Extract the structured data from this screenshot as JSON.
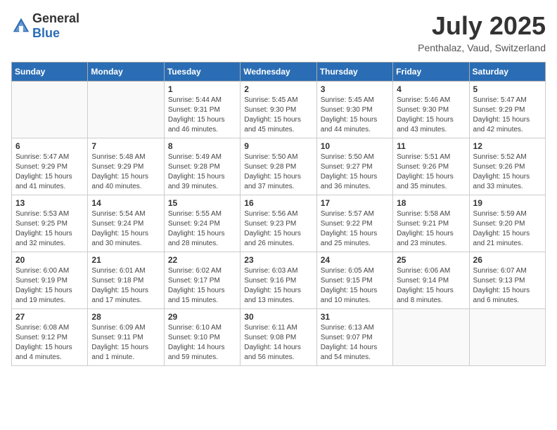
{
  "header": {
    "logo_general": "General",
    "logo_blue": "Blue",
    "month": "July 2025",
    "location": "Penthalaz, Vaud, Switzerland"
  },
  "weekdays": [
    "Sunday",
    "Monday",
    "Tuesday",
    "Wednesday",
    "Thursday",
    "Friday",
    "Saturday"
  ],
  "weeks": [
    [
      {
        "day": "",
        "info": ""
      },
      {
        "day": "",
        "info": ""
      },
      {
        "day": "1",
        "info": "Sunrise: 5:44 AM\nSunset: 9:31 PM\nDaylight: 15 hours and 46 minutes."
      },
      {
        "day": "2",
        "info": "Sunrise: 5:45 AM\nSunset: 9:30 PM\nDaylight: 15 hours and 45 minutes."
      },
      {
        "day": "3",
        "info": "Sunrise: 5:45 AM\nSunset: 9:30 PM\nDaylight: 15 hours and 44 minutes."
      },
      {
        "day": "4",
        "info": "Sunrise: 5:46 AM\nSunset: 9:30 PM\nDaylight: 15 hours and 43 minutes."
      },
      {
        "day": "5",
        "info": "Sunrise: 5:47 AM\nSunset: 9:29 PM\nDaylight: 15 hours and 42 minutes."
      }
    ],
    [
      {
        "day": "6",
        "info": "Sunrise: 5:47 AM\nSunset: 9:29 PM\nDaylight: 15 hours and 41 minutes."
      },
      {
        "day": "7",
        "info": "Sunrise: 5:48 AM\nSunset: 9:29 PM\nDaylight: 15 hours and 40 minutes."
      },
      {
        "day": "8",
        "info": "Sunrise: 5:49 AM\nSunset: 9:28 PM\nDaylight: 15 hours and 39 minutes."
      },
      {
        "day": "9",
        "info": "Sunrise: 5:50 AM\nSunset: 9:28 PM\nDaylight: 15 hours and 37 minutes."
      },
      {
        "day": "10",
        "info": "Sunrise: 5:50 AM\nSunset: 9:27 PM\nDaylight: 15 hours and 36 minutes."
      },
      {
        "day": "11",
        "info": "Sunrise: 5:51 AM\nSunset: 9:26 PM\nDaylight: 15 hours and 35 minutes."
      },
      {
        "day": "12",
        "info": "Sunrise: 5:52 AM\nSunset: 9:26 PM\nDaylight: 15 hours and 33 minutes."
      }
    ],
    [
      {
        "day": "13",
        "info": "Sunrise: 5:53 AM\nSunset: 9:25 PM\nDaylight: 15 hours and 32 minutes."
      },
      {
        "day": "14",
        "info": "Sunrise: 5:54 AM\nSunset: 9:24 PM\nDaylight: 15 hours and 30 minutes."
      },
      {
        "day": "15",
        "info": "Sunrise: 5:55 AM\nSunset: 9:24 PM\nDaylight: 15 hours and 28 minutes."
      },
      {
        "day": "16",
        "info": "Sunrise: 5:56 AM\nSunset: 9:23 PM\nDaylight: 15 hours and 26 minutes."
      },
      {
        "day": "17",
        "info": "Sunrise: 5:57 AM\nSunset: 9:22 PM\nDaylight: 15 hours and 25 minutes."
      },
      {
        "day": "18",
        "info": "Sunrise: 5:58 AM\nSunset: 9:21 PM\nDaylight: 15 hours and 23 minutes."
      },
      {
        "day": "19",
        "info": "Sunrise: 5:59 AM\nSunset: 9:20 PM\nDaylight: 15 hours and 21 minutes."
      }
    ],
    [
      {
        "day": "20",
        "info": "Sunrise: 6:00 AM\nSunset: 9:19 PM\nDaylight: 15 hours and 19 minutes."
      },
      {
        "day": "21",
        "info": "Sunrise: 6:01 AM\nSunset: 9:18 PM\nDaylight: 15 hours and 17 minutes."
      },
      {
        "day": "22",
        "info": "Sunrise: 6:02 AM\nSunset: 9:17 PM\nDaylight: 15 hours and 15 minutes."
      },
      {
        "day": "23",
        "info": "Sunrise: 6:03 AM\nSunset: 9:16 PM\nDaylight: 15 hours and 13 minutes."
      },
      {
        "day": "24",
        "info": "Sunrise: 6:05 AM\nSunset: 9:15 PM\nDaylight: 15 hours and 10 minutes."
      },
      {
        "day": "25",
        "info": "Sunrise: 6:06 AM\nSunset: 9:14 PM\nDaylight: 15 hours and 8 minutes."
      },
      {
        "day": "26",
        "info": "Sunrise: 6:07 AM\nSunset: 9:13 PM\nDaylight: 15 hours and 6 minutes."
      }
    ],
    [
      {
        "day": "27",
        "info": "Sunrise: 6:08 AM\nSunset: 9:12 PM\nDaylight: 15 hours and 4 minutes."
      },
      {
        "day": "28",
        "info": "Sunrise: 6:09 AM\nSunset: 9:11 PM\nDaylight: 15 hours and 1 minute."
      },
      {
        "day": "29",
        "info": "Sunrise: 6:10 AM\nSunset: 9:10 PM\nDaylight: 14 hours and 59 minutes."
      },
      {
        "day": "30",
        "info": "Sunrise: 6:11 AM\nSunset: 9:08 PM\nDaylight: 14 hours and 56 minutes."
      },
      {
        "day": "31",
        "info": "Sunrise: 6:13 AM\nSunset: 9:07 PM\nDaylight: 14 hours and 54 minutes."
      },
      {
        "day": "",
        "info": ""
      },
      {
        "day": "",
        "info": ""
      }
    ]
  ]
}
